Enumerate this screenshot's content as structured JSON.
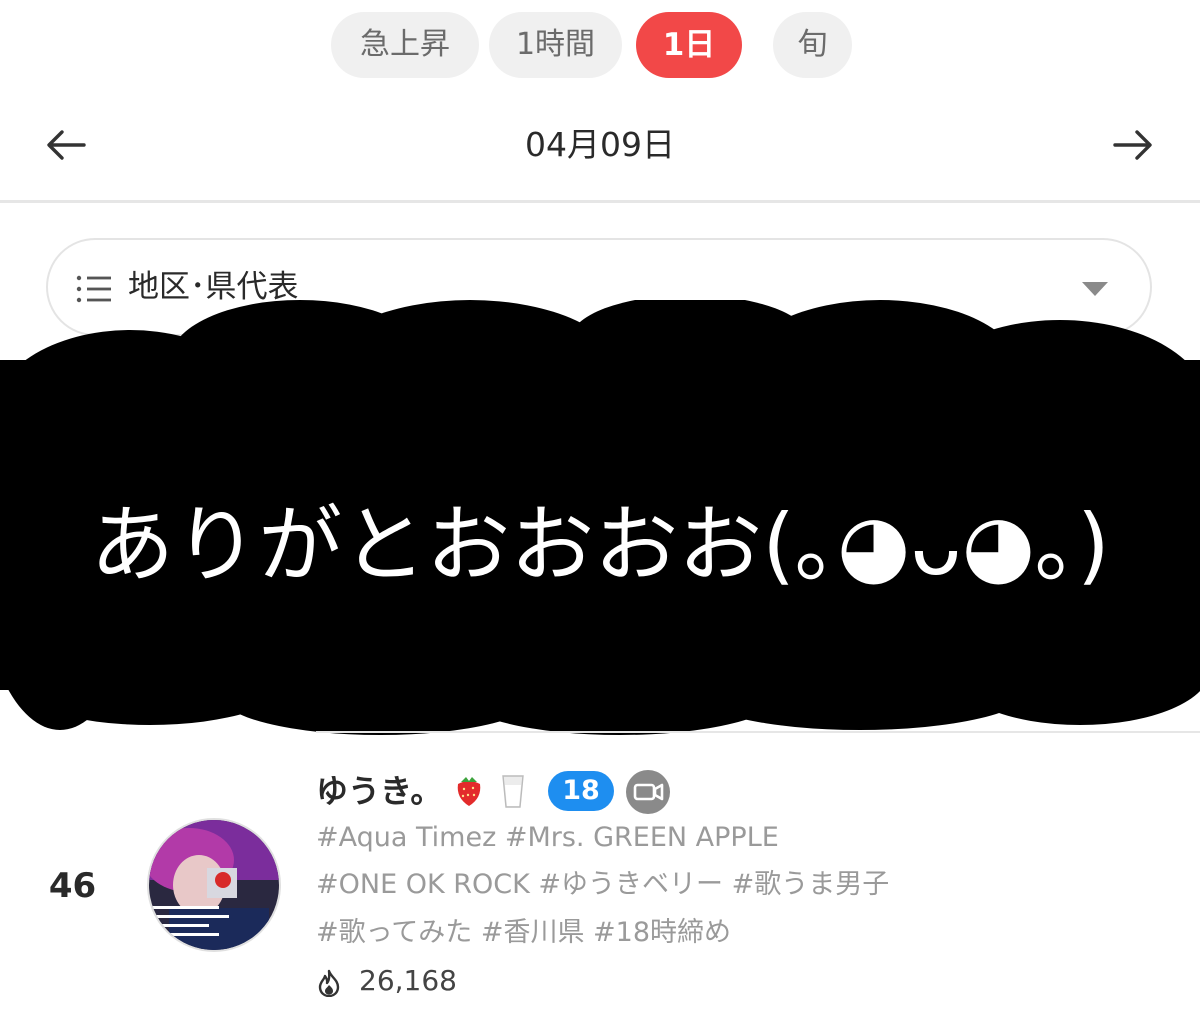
{
  "tabs": [
    {
      "label": "急上昇",
      "active": false
    },
    {
      "label": "1時間",
      "active": false
    },
    {
      "label": "1日",
      "active": true
    },
    {
      "label": "旬",
      "active": false
    }
  ],
  "date_nav": {
    "date": "04月09日",
    "prev_icon": "arrow-left-icon",
    "next_icon": "arrow-right-icon"
  },
  "region_filter": {
    "label": "地区･県代表",
    "icon": "list-icon",
    "caret_icon": "caret-down-icon"
  },
  "overlay": {
    "text": "ありがとおおおお(｡◕ᴗ◕｡)"
  },
  "entry": {
    "rank": "46",
    "name": "ゆうき。",
    "emojis": [
      "strawberry-icon",
      "milk-glass-icon"
    ],
    "age_badge": "18",
    "video_icon": "video-camera-icon",
    "tags": [
      "#Aqua Timez #Mrs. GREEN APPLE",
      "#ONE OK ROCK #ゆうきベリー #歌うま男子",
      "#歌ってみた #香川県 #18時締め"
    ],
    "score_icon": "flame-icon",
    "score": "26,168"
  },
  "colors": {
    "active_tab": "#f24848",
    "inactive_tab_bg": "#f0f0f0",
    "badge_blue": "#1e8ef0",
    "icon_gray": "#8a8a8a",
    "overlay": "#000000"
  }
}
